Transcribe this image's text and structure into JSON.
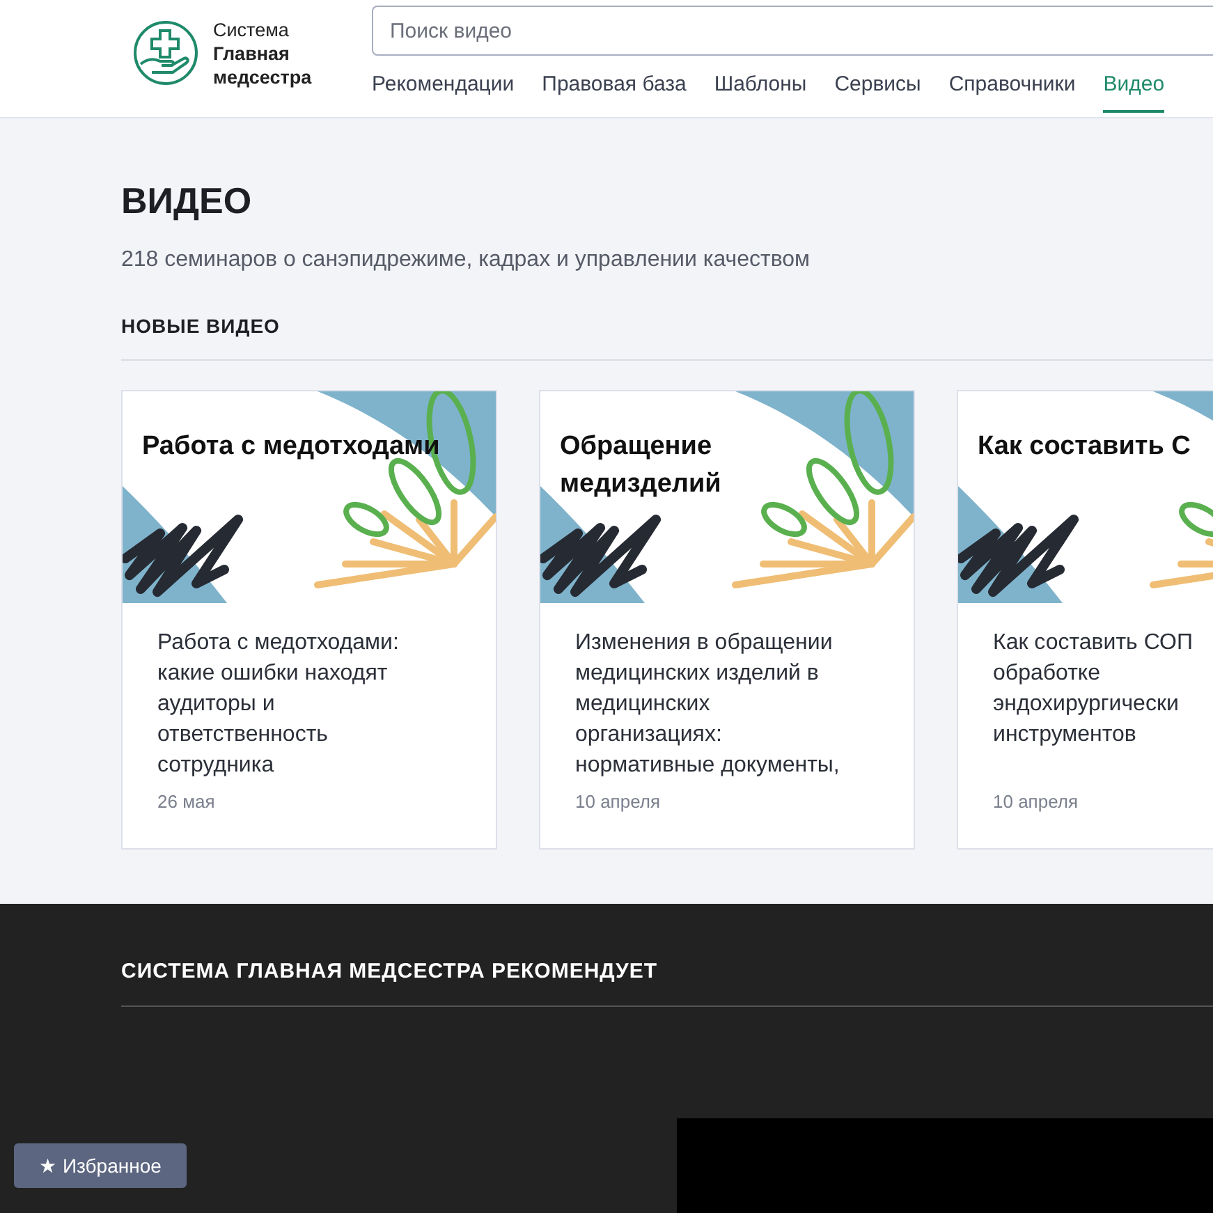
{
  "header": {
    "logo_text": "Система **Главная медсестра**",
    "search": {
      "placeholder": "Поиск видео"
    },
    "nav": [
      {
        "label": "Рекомендации",
        "selected": false
      },
      {
        "label": "Правовая база",
        "selected": false
      },
      {
        "label": "Шаблоны",
        "selected": false
      },
      {
        "label": "Сервисы",
        "selected": false
      },
      {
        "label": "Справочники",
        "selected": false
      },
      {
        "label": "Видео",
        "selected": true
      }
    ]
  },
  "page": {
    "title": "ВИДЕО",
    "subtitle": "218 семинаров о санэпидрежиме, кадрах и управлении качеством",
    "section_title": "НОВЫЕ ВИДЕО",
    "cards": [
      {
        "cover_title": [
          "Работа с медотходами"
        ],
        "description": [
          "Работа с медотходами:",
          "какие ошибки находят",
          "аудиторы и",
          "ответственность",
          "сотрудника"
        ],
        "date": "26 мая"
      },
      {
        "cover_title": [
          "Обращение",
          "медизделий"
        ],
        "description": [
          "Изменения в обращении",
          "медицинских изделий в",
          "медицинских",
          "организациях:",
          "нормативные документы,"
        ],
        "date": "10 апреля"
      },
      {
        "cover_title": [
          "Как составить С"
        ],
        "description": [
          "Как составить СОП",
          "обработке",
          "эндохирургически",
          "инструментов"
        ],
        "date": "10 апреля"
      }
    ]
  },
  "recommend": {
    "title": "СИСТЕМА ГЛАВНАЯ МЕДСЕСТРА РЕКОМЕНДУЕТ"
  },
  "favorites_button": {
    "icon": "★",
    "label": "Избранное"
  }
}
